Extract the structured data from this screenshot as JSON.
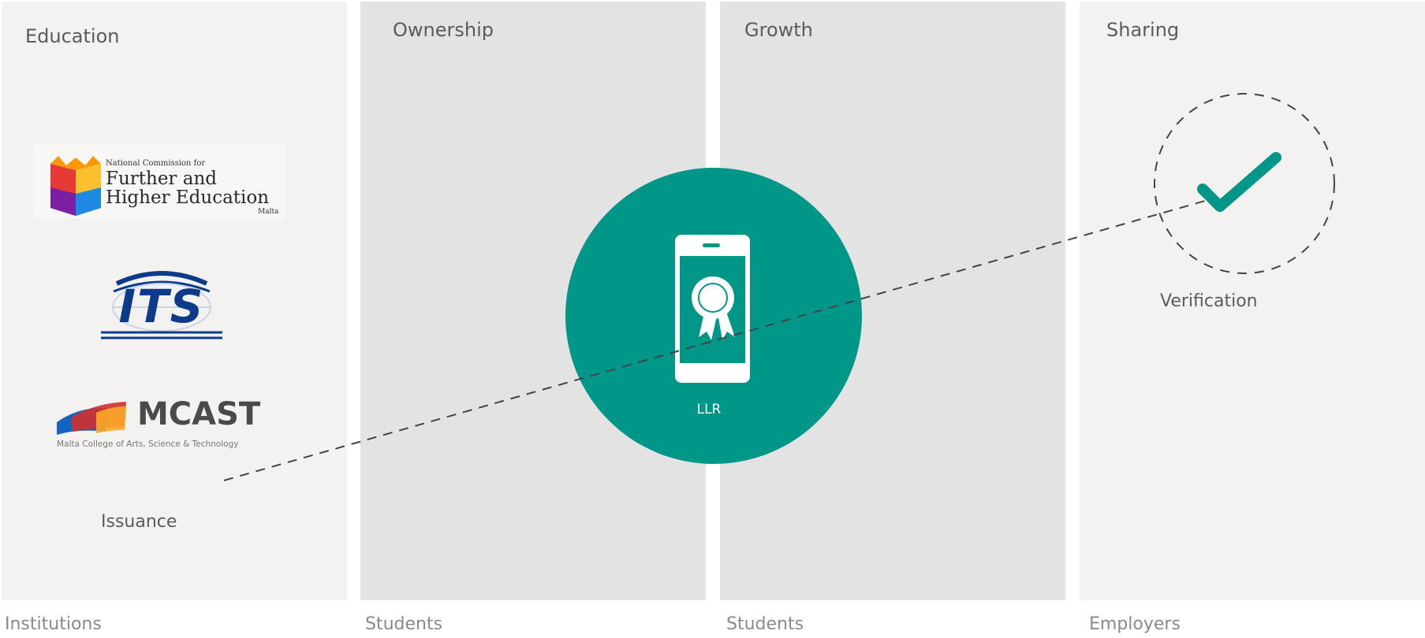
{
  "columns": [
    {
      "title": "Education",
      "footer": "Institutions"
    },
    {
      "title": "Ownership",
      "footer": "Students"
    },
    {
      "title": "Growth",
      "footer": "Students"
    },
    {
      "title": "Sharing",
      "footer": "Employers"
    }
  ],
  "logos": {
    "ncfhe": {
      "line1": "National Commission for",
      "line2": "Further and",
      "line3": "Higher Education",
      "line4": "Malta"
    },
    "its": {
      "text": "ITS"
    },
    "mcast": {
      "name": "MCAST",
      "tagline": "Malta College of Arts, Science & Technology"
    }
  },
  "labels": {
    "issuance": "Issuance",
    "llr": "LLR",
    "verification": "Verification"
  },
  "icons": {
    "phone": "smartphone-icon",
    "certificate": "award-ribbon-icon",
    "check": "checkmark-icon"
  },
  "colors": {
    "accent": "#009688",
    "panel_light": "#f3f2f1",
    "panel_grey": "#e3e3e3"
  }
}
